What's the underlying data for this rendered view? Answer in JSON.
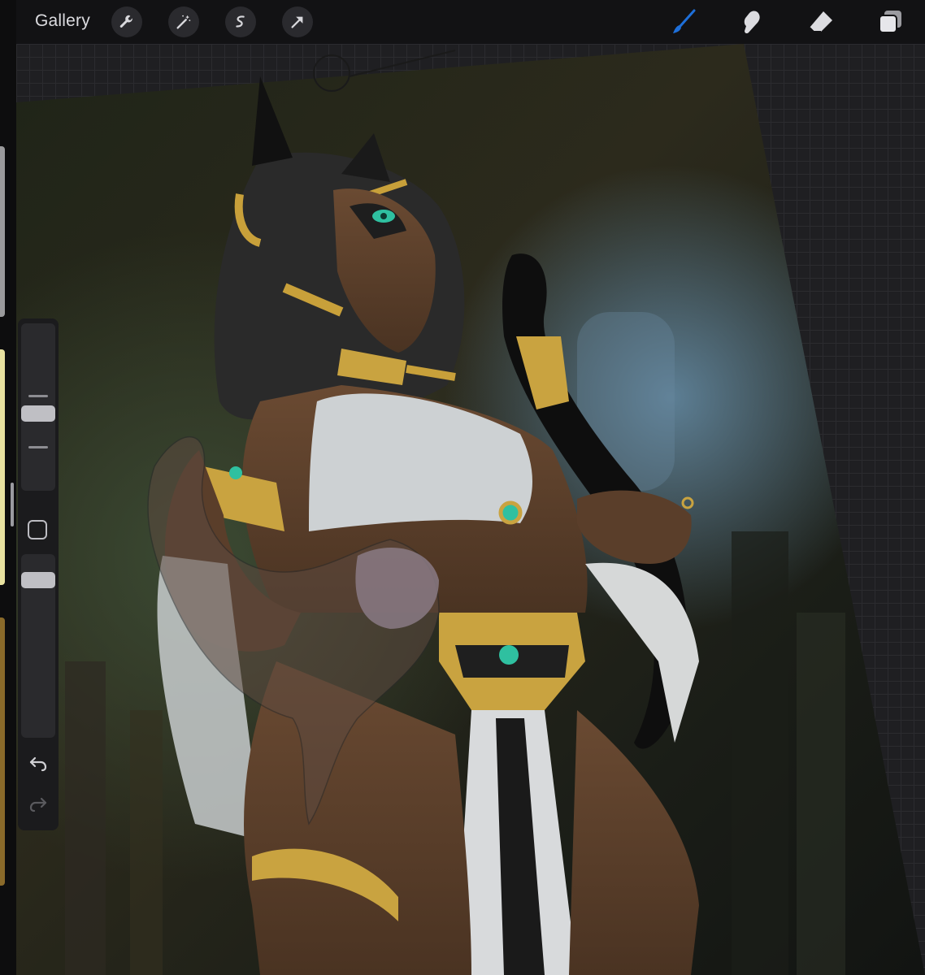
{
  "toolbar": {
    "gallery_label": "Gallery",
    "left_tools": [
      "wrench-icon",
      "magic-wand-icon",
      "selection-icon",
      "transform-arrow-icon"
    ],
    "right_tools": [
      "brush-icon",
      "smudge-icon",
      "eraser-icon",
      "layers-icon"
    ],
    "active_tool": "brush-icon",
    "accent_color": "#1e6fd9"
  },
  "sidebar": {
    "brush_size_level": 0.55,
    "opacity_level": 0.75,
    "controls": [
      "brush-size-slider",
      "modify-button",
      "opacity-slider",
      "undo-icon",
      "redo-icon"
    ]
  },
  "canvas": {
    "content": "illustration",
    "background": "grid"
  }
}
